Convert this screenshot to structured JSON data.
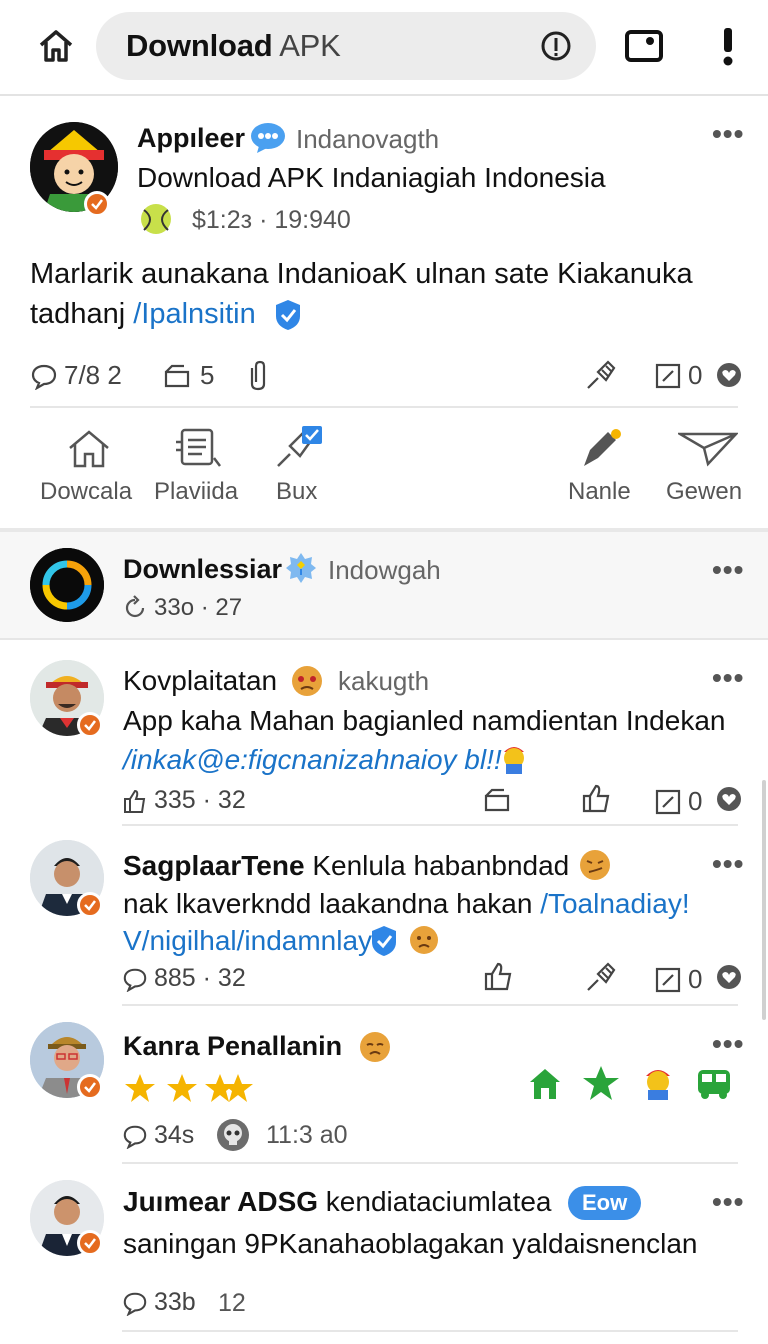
{
  "browser": {
    "url_strong": "Download",
    "url_light": " APK"
  },
  "post1": {
    "name": "Appıleer",
    "handle": "Indanovagth",
    "title": "Download APK Indaniagiah Indonesia",
    "meta": "$1:2з · 19:940",
    "body_line1": "Marlarik aunakana IndanioaK ulnan sate Kiakanuka",
    "body_line2_text": "tadhanj ",
    "body_line2_link": "/Ipalnsitin",
    "comments": "7/8 2",
    "shares": "5",
    "likes": "0",
    "actions": [
      "Dowcala",
      "Plaviida",
      "Bux",
      "Nanle",
      "Gewen"
    ]
  },
  "post2": {
    "name": "Downlessiar",
    "handle": "Indowgah",
    "meta": "33o · 27"
  },
  "post3": {
    "name": "Kovplaitatan",
    "handle": "kakugth",
    "line1": "App kaha Mahan  bagianled namdientan Indekan",
    "link": "/inkak@e:figcnanizahnaioy bl!!",
    "count": "335 · 32",
    "likes": "0"
  },
  "post4": {
    "name": "SagplaarTene",
    "line1_rest": " Kenlula habanbndad",
    "line2_text": "nak lkaverkndd laakandna hakan ",
    "line2_link": "/Toalnadiay!",
    "line3_link": "V/nigilhal/indamnlay",
    "count": "885 · 32",
    "likes": "0"
  },
  "post5": {
    "name": "Kanra Penallanin",
    "count": "34s",
    "time": "11:3 a0"
  },
  "post6": {
    "name": "Juımear ADSG",
    "name_rest": " kendiataciumlatea",
    "pill": "Eow",
    "line1": "saningan 9PKanahaoblagakan yaldaisnenclan",
    "count": "33b",
    "count2": "12"
  },
  "colors": {
    "accent": "#1a73c8",
    "badge": "#e56b1f",
    "green": "#2aa43a",
    "star": "#f5b400"
  }
}
